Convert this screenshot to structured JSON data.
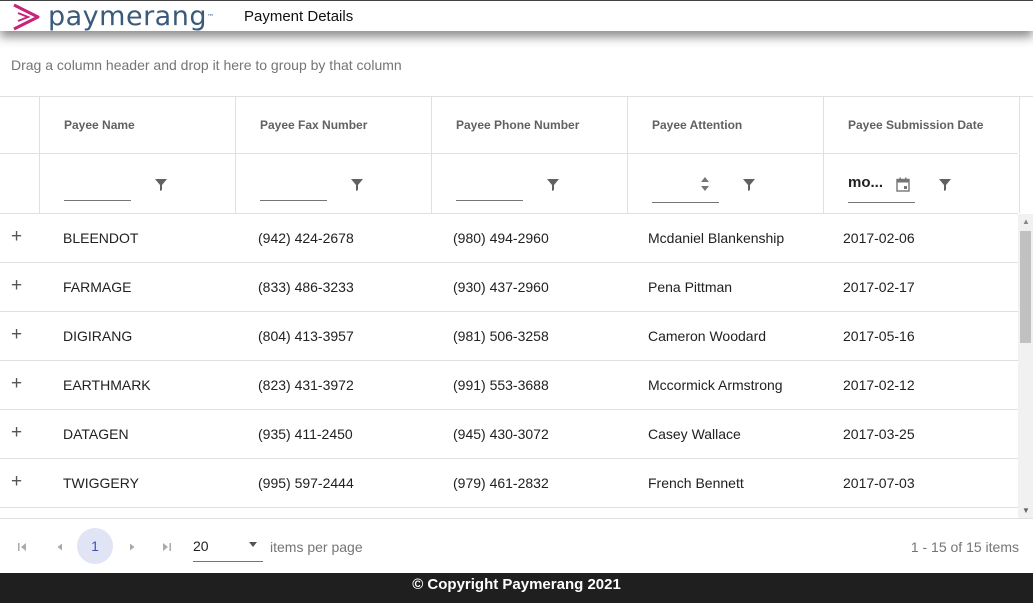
{
  "header": {
    "logo_text": "paymerang",
    "logo_tm": "™",
    "page_title": "Payment Details",
    "brand_color": "#c7237b",
    "brand_text_color": "#3a5a7a"
  },
  "grid": {
    "group_hint": "Drag a column header and drop it here to group by that column",
    "columns": [
      "Payee Name",
      "Payee Fax Number",
      "Payee Phone Number",
      "Payee Attention",
      "Payee Submission Date"
    ],
    "date_filter_value": "mo...",
    "expand_symbol": "+",
    "rows": [
      [
        "BLEENDOT",
        "(942) 424-2678",
        "(980) 494-2960",
        "Mcdaniel Blankenship",
        "2017-02-06"
      ],
      [
        "FARMAGE",
        "(833) 486-3233",
        "(930) 437-2960",
        "Pena Pittman",
        "2017-02-17"
      ],
      [
        "DIGIRANG",
        "(804) 413-3957",
        "(981) 506-3258",
        "Cameron Woodard",
        "2017-05-16"
      ],
      [
        "EARTHMARK",
        "(823) 431-3972",
        "(991) 553-3688",
        "Mccormick Armstrong",
        "2017-02-12"
      ],
      [
        "DATAGEN",
        "(935) 411-2450",
        "(945) 430-3072",
        "Casey Wallace",
        "2017-03-25"
      ],
      [
        "TWIGGERY",
        "(995) 597-2444",
        "(979) 461-2832",
        "French Bennett",
        "2017-07-03"
      ]
    ]
  },
  "pager": {
    "current_page": "1",
    "page_size": "20",
    "items_per_page_label": "items per page",
    "info": "1 - 15 of 15 items"
  },
  "footer": {
    "copyright": "© Copyright Paymerang 2021",
    "background": "#1f1f1f"
  }
}
